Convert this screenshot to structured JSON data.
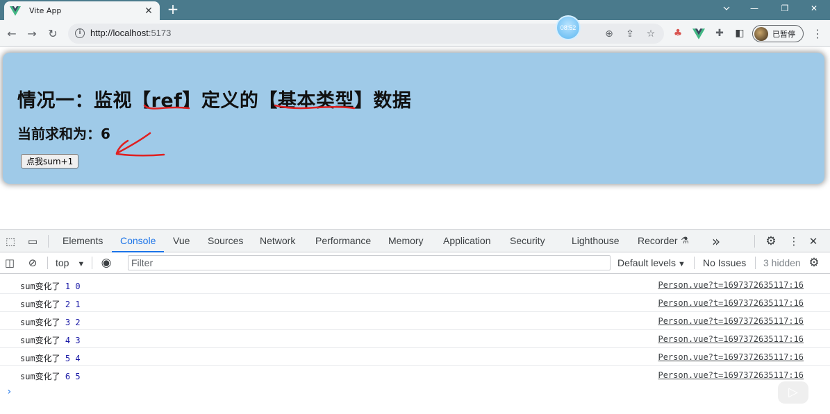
{
  "browser": {
    "tab_title": "Vite App",
    "tab_close": "✕",
    "new_tab": "+",
    "window_minimize": "—",
    "window_restore": "❐",
    "window_close": "✕",
    "url_scheme_host": "http://localhost",
    "url_port": ":5173",
    "timer_text": "08:52",
    "profile_label": "已暂停",
    "accent_color": "#4a7a8c"
  },
  "page": {
    "title": "情况一：监视【ref】定义的【基本类型】数据",
    "sum_label": "当前求和为：",
    "sum_value": "6",
    "button_label": "点我sum+1",
    "card_color": "#9fcae8"
  },
  "devtools": {
    "tabs": [
      {
        "label": "Elements"
      },
      {
        "label": "Console",
        "active": true
      },
      {
        "label": "Vue"
      },
      {
        "label": "Sources"
      },
      {
        "label": "Network"
      },
      {
        "label": "Performance"
      },
      {
        "label": "Memory"
      },
      {
        "label": "Application"
      },
      {
        "label": "Security"
      },
      {
        "label": "Lighthouse"
      },
      {
        "label": "Recorder"
      }
    ],
    "more_tabs": "»",
    "context": "top",
    "filter_placeholder": "Filter",
    "levels_label": "Default levels",
    "issues_label": "No Issues",
    "hidden_label": "3 hidden",
    "prompt": "›",
    "logs": [
      {
        "prefix": "sum变化了",
        "a": "1",
        "b": "0",
        "source": "Person.vue?t=1697372635117:16"
      },
      {
        "prefix": "sum变化了",
        "a": "2",
        "b": "1",
        "source": "Person.vue?t=1697372635117:16"
      },
      {
        "prefix": "sum变化了",
        "a": "3",
        "b": "2",
        "source": "Person.vue?t=1697372635117:16"
      },
      {
        "prefix": "sum变化了",
        "a": "4",
        "b": "3",
        "source": "Person.vue?t=1697372635117:16"
      },
      {
        "prefix": "sum变化了",
        "a": "5",
        "b": "4",
        "source": "Person.vue?t=1697372635117:16"
      },
      {
        "prefix": "sum变化了",
        "a": "6",
        "b": "5",
        "source": "Person.vue?t=1697372635117:16"
      }
    ]
  }
}
